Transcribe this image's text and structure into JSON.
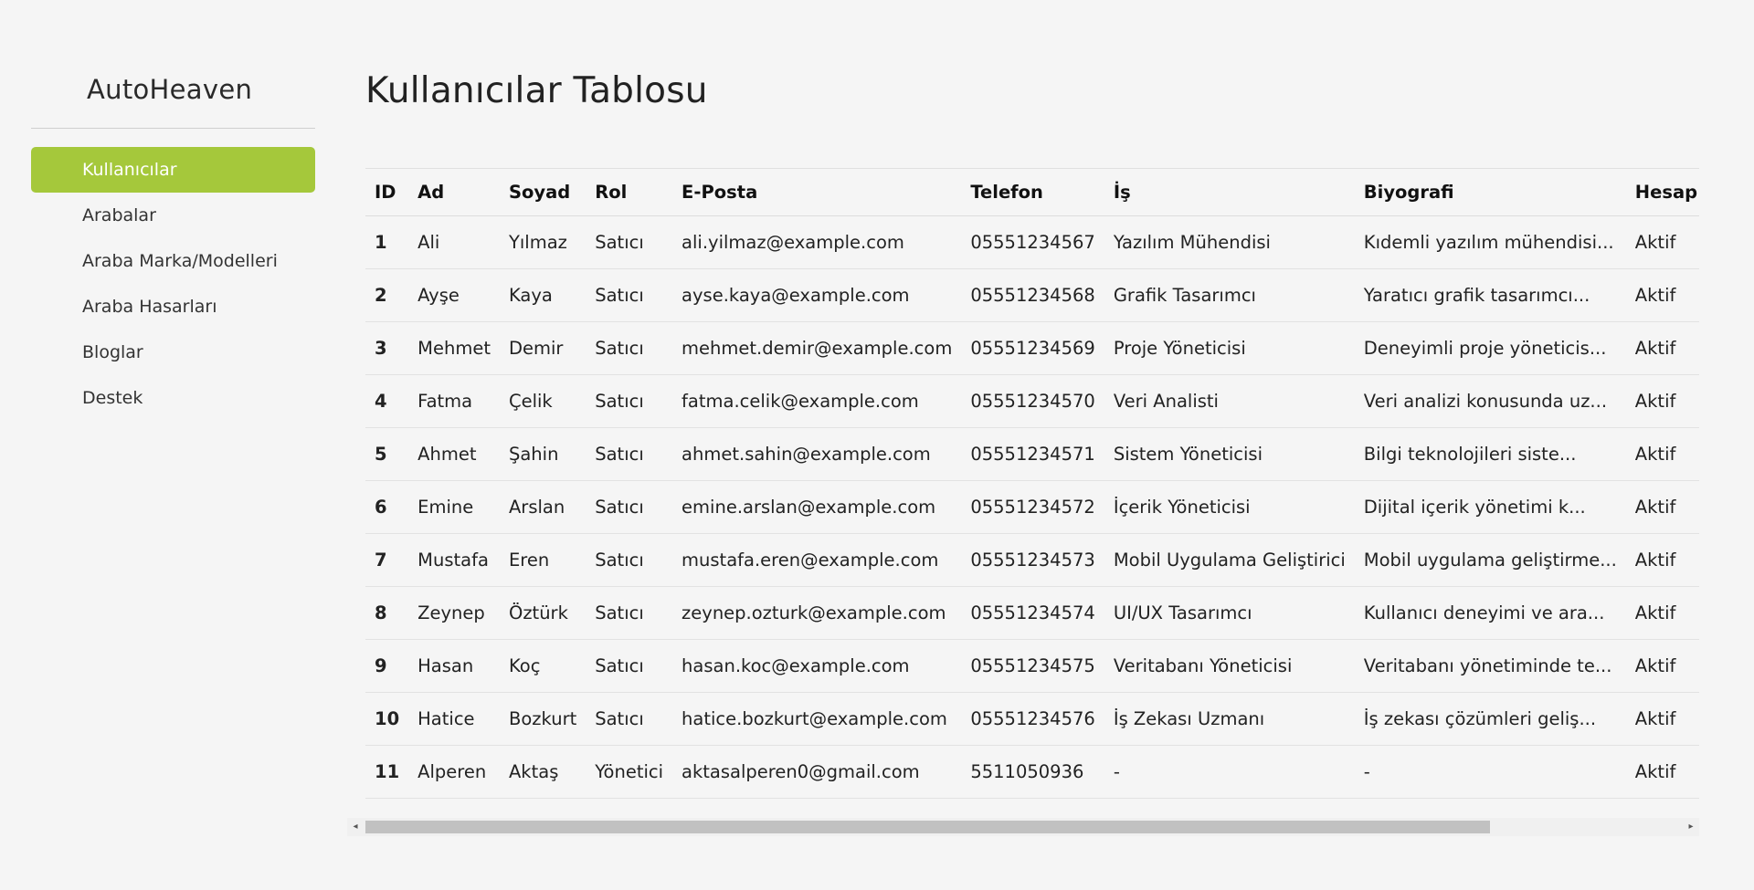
{
  "sidebar": {
    "brand": "AutoHeaven",
    "items": [
      {
        "label": "Kullanıcılar",
        "active": true
      },
      {
        "label": "Arabalar",
        "active": false
      },
      {
        "label": "Araba Marka/Modelleri",
        "active": false
      },
      {
        "label": "Araba Hasarları",
        "active": false
      },
      {
        "label": "Bloglar",
        "active": false
      },
      {
        "label": "Destek",
        "active": false
      }
    ]
  },
  "main": {
    "title": "Kullanıcılar Tablosu",
    "columns": [
      "ID",
      "Ad",
      "Soyad",
      "Rol",
      "E-Posta",
      "Telefon",
      "İş",
      "Biyografi",
      "Hesap"
    ],
    "rows": [
      [
        "1",
        "Ali",
        "Yılmaz",
        "Satıcı",
        "ali.yilmaz@example.com",
        "05551234567",
        "Yazılım Mühendisi",
        "Kıdemli yazılım mühendisi...",
        "Aktif"
      ],
      [
        "2",
        "Ayşe",
        "Kaya",
        "Satıcı",
        "ayse.kaya@example.com",
        "05551234568",
        "Grafik Tasarımcı",
        "Yaratıcı grafik tasarımcı...",
        "Aktif"
      ],
      [
        "3",
        "Mehmet",
        "Demir",
        "Satıcı",
        "mehmet.demir@example.com",
        "05551234569",
        "Proje Yöneticisi",
        "Deneyimli proje yöneticis...",
        "Aktif"
      ],
      [
        "4",
        "Fatma",
        "Çelik",
        "Satıcı",
        "fatma.celik@example.com",
        "05551234570",
        "Veri Analisti",
        "Veri analizi konusunda uz...",
        "Aktif"
      ],
      [
        "5",
        "Ahmet",
        "Şahin",
        "Satıcı",
        "ahmet.sahin@example.com",
        "05551234571",
        "Sistem Yöneticisi",
        "Bilgi teknolojileri siste...",
        "Aktif"
      ],
      [
        "6",
        "Emine",
        "Arslan",
        "Satıcı",
        "emine.arslan@example.com",
        "05551234572",
        "İçerik Yöneticisi",
        "Dijital içerik yönetimi k...",
        "Aktif"
      ],
      [
        "7",
        "Mustafa",
        "Eren",
        "Satıcı",
        "mustafa.eren@example.com",
        "05551234573",
        "Mobil Uygulama Geliştirici",
        "Mobil uygulama geliştirme...",
        "Aktif"
      ],
      [
        "8",
        "Zeynep",
        "Öztürk",
        "Satıcı",
        "zeynep.ozturk@example.com",
        "05551234574",
        "UI/UX Tasarımcı",
        "Kullanıcı deneyimi ve ara...",
        "Aktif"
      ],
      [
        "9",
        "Hasan",
        "Koç",
        "Satıcı",
        "hasan.koc@example.com",
        "05551234575",
        "Veritabanı Yöneticisi",
        "Veritabanı yönetiminde te...",
        "Aktif"
      ],
      [
        "10",
        "Hatice",
        "Bozkurt",
        "Satıcı",
        "hatice.bozkurt@example.com",
        "05551234576",
        "İş Zekası Uzmanı",
        "İş zekası çözümleri geliş...",
        "Aktif"
      ],
      [
        "11",
        "Alperen",
        "Aktaş",
        "Yönetici",
        "aktasalperen0@gmail.com",
        "5511050936",
        "-",
        "-",
        "Aktif"
      ]
    ]
  },
  "scrollbar": {
    "left_arrow": "◂",
    "right_arrow": "▸"
  },
  "colors": {
    "accent": "#a5c83b",
    "background": "#f5f5f5"
  }
}
